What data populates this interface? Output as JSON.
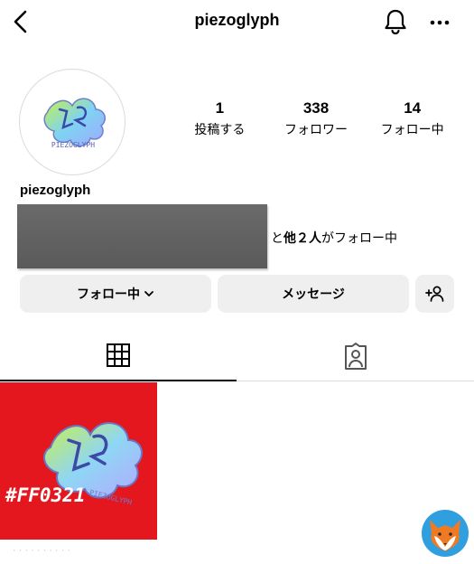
{
  "header": {
    "title": "piezoglyph",
    "back_icon": "chevron-left-icon",
    "bell_icon": "bell-icon",
    "more_icon": "more-horizontal-icon"
  },
  "profile": {
    "avatar_text": "PIEZOGLYPH",
    "username": "piezoglyph",
    "stats": [
      {
        "value": "1",
        "label": "投稿する"
      },
      {
        "value": "338",
        "label": "フォロワー"
      },
      {
        "value": "14",
        "label": "フォロー中"
      }
    ],
    "followed_by_prefix": "と",
    "followed_by_bold": "他２人",
    "followed_by_suffix": "がフォロー中"
  },
  "actions": {
    "following_label": "フォロー中",
    "message_label": "メッセージ",
    "add_friend_icon": "add-person-icon"
  },
  "tabs": [
    {
      "icon": "grid-icon",
      "active": true
    },
    {
      "icon": "tagged-person-icon",
      "active": false
    }
  ],
  "post": {
    "caption_text": "#FF0321",
    "logo_text": "PIEZOGLYPH",
    "background": "#e3171d"
  },
  "colors": {
    "button_bg": "#efefef",
    "divider": "#dbdbdb"
  }
}
